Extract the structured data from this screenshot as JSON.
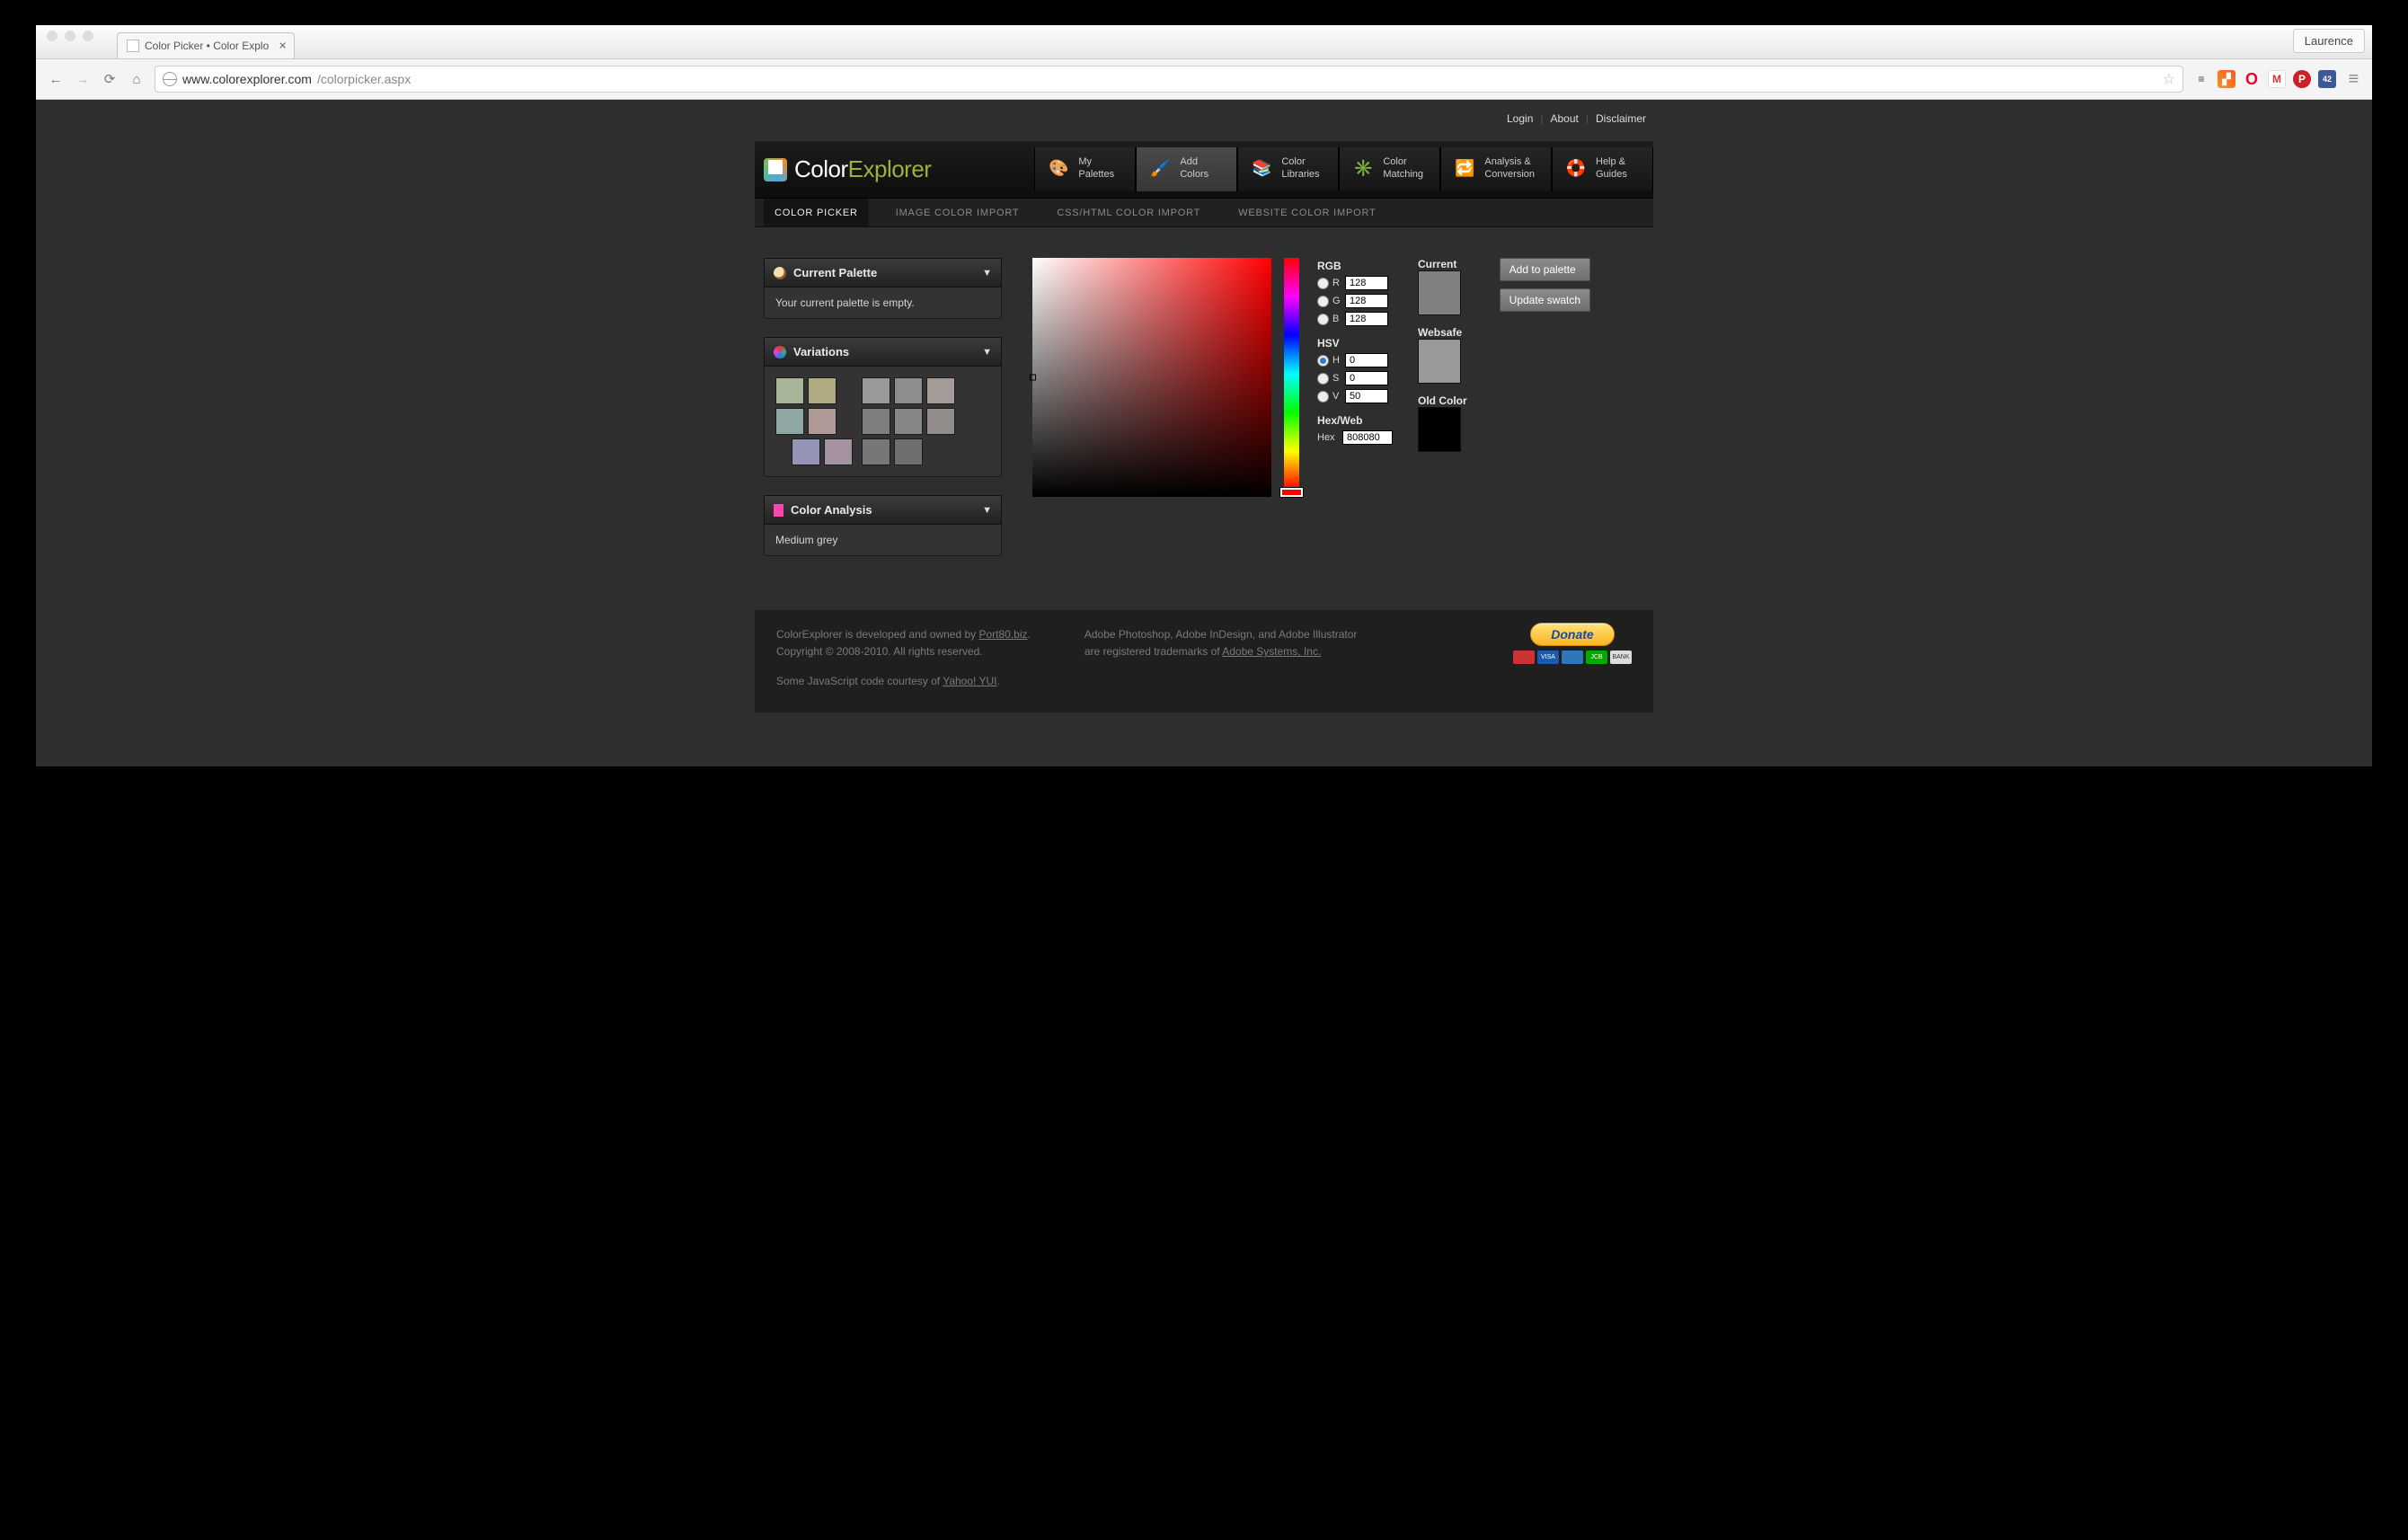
{
  "browser": {
    "tab_title": "Color Picker • Color Explo",
    "profile": "Laurence",
    "url_host": "www.colorexplorer.com",
    "url_path": "/colorpicker.aspx"
  },
  "top_links": {
    "login": "Login",
    "about": "About",
    "disclaimer": "Disclaimer"
  },
  "logo": {
    "pre": "Color",
    "post": "Explorer"
  },
  "nav": {
    "items": [
      {
        "l1": "My",
        "l2": "Palettes"
      },
      {
        "l1": "Add",
        "l2": "Colors"
      },
      {
        "l1": "Color",
        "l2": "Libraries"
      },
      {
        "l1": "Color",
        "l2": "Matching"
      },
      {
        "l1": "Analysis &",
        "l2": "Conversion"
      },
      {
        "l1": "Help &",
        "l2": "Guides"
      }
    ]
  },
  "subnav": {
    "items": [
      "COLOR PICKER",
      "IMAGE COLOR IMPORT",
      "CSS/HTML COLOR IMPORT",
      "WEBSITE COLOR IMPORT"
    ]
  },
  "sidebar": {
    "current_palette": {
      "title": "Current Palette",
      "body": "Your current palette is empty."
    },
    "variations": {
      "title": "Variations",
      "left": [
        "#a8b598",
        "#b0ab82",
        "#8fa7a3",
        "#b09a98",
        "#9694b6",
        "#a592a1"
      ],
      "right": [
        "#9a9a9a",
        "#8d8d8d",
        "#a29b98",
        "#7f7f7f",
        "#868686",
        "#928d8a",
        "#777777",
        "#6f6f6f"
      ]
    },
    "analysis": {
      "title": "Color Analysis",
      "body": "Medium grey"
    }
  },
  "picker": {
    "rgb_label": "RGB",
    "r_label": "R",
    "g_label": "G",
    "b_label": "B",
    "r": "128",
    "g": "128",
    "b": "128",
    "hsv_label": "HSV",
    "h_label": "H",
    "s_label": "S",
    "v_label": "V",
    "h": "0",
    "s": "0",
    "v": "50",
    "hexweb_label": "Hex/Web",
    "hex_label": "Hex",
    "hex": "808080",
    "swatches": {
      "current_label": "Current",
      "current_color": "#808080",
      "websafe_label": "Websafe",
      "websafe_color": "#999999",
      "old_label": "Old Color",
      "old_color": "#000000"
    },
    "actions": {
      "add": "Add to palette",
      "update": "Update swatch"
    }
  },
  "footer": {
    "line1_pre": "ColorExplorer is developed and owned by ",
    "line1_link": "Port80.biz",
    "line2": "Copyright © 2008-2010. All rights reserved.",
    "line3_pre": "Some JavaScript code courtesy of ",
    "line3_link": "Yahoo! YUI",
    "col2_line1": "Adobe Photoshop, Adobe InDesign, and Adobe Illustrator",
    "col2_line2_pre": "are registered trademarks of ",
    "col2_line2_link": "Adobe Systems, Inc.",
    "donate": "Donate"
  }
}
